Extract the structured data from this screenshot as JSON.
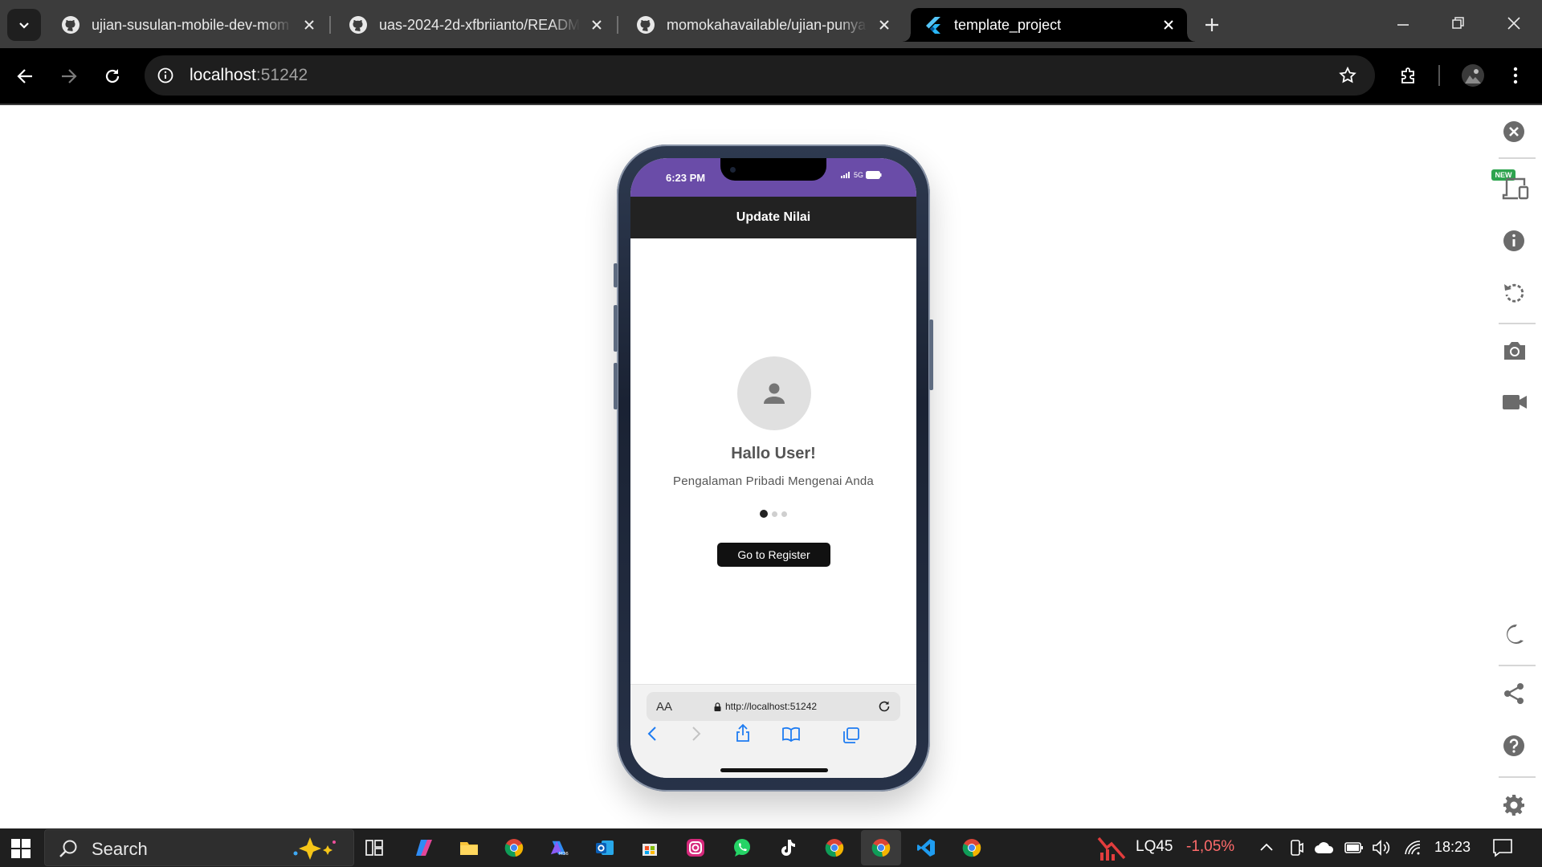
{
  "browser": {
    "tabs": [
      {
        "title": "ujian-susulan-mobile-dev-mom",
        "active": false
      },
      {
        "title": "uas-2024-2d-xfbriianto/READM",
        "active": false
      },
      {
        "title": "momokahavailable/ujian-punya",
        "active": false
      },
      {
        "title": "template_project",
        "active": true
      }
    ],
    "address": {
      "host": "localhost",
      "port": ":51242"
    }
  },
  "phone": {
    "status_time": "6:23 PM",
    "network": "5G",
    "appbar_title": "Update Nilai",
    "greeting": "Hallo User!",
    "subtitle": "Pengalaman Pribadi Mengenai Anda",
    "page_indicator": {
      "count": 3,
      "active": 0
    },
    "register_button": "Go to Register",
    "safari": {
      "aa": "AA",
      "url": "http://localhost:51242"
    }
  },
  "devtools_sidebar": {
    "new_badge": "NEW",
    "icons": [
      "close-icon",
      "device-icon",
      "info-icon",
      "rotate-icon",
      "camera-icon",
      "video-icon",
      "moon-icon",
      "share-icon",
      "help-icon",
      "settings-icon"
    ]
  },
  "taskbar": {
    "search_placeholder": "Search",
    "stock_name": "LQ45",
    "stock_change": "-1,05%",
    "clock": "18:23"
  },
  "colors": {
    "statusbar": "#6a4ca8",
    "appbar": "#222222",
    "stock_negative": "#ff6b6b",
    "new_badge": "#2ea44f"
  }
}
